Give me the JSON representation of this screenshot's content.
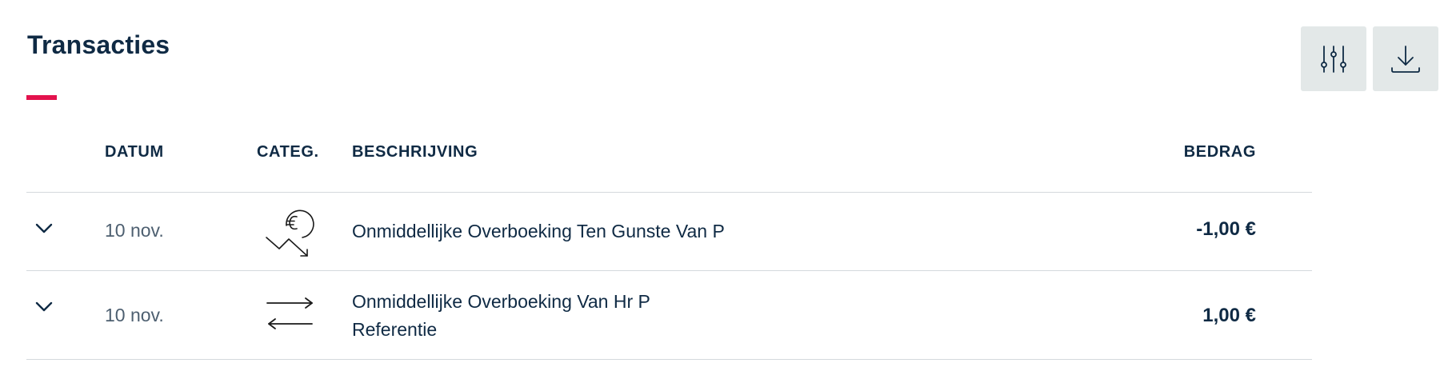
{
  "header": {
    "title": "Transacties",
    "accent_color": "#e3124d",
    "filter_button_icon": "sliders-icon",
    "download_button_icon": "download-icon"
  },
  "table": {
    "columns": {
      "datum": "DATUM",
      "categ": "CATEG.",
      "beschrijving": "BESCHRIJVING",
      "bedrag": "BEDRAG"
    },
    "rows": [
      {
        "date": "10 nov.",
        "category_icon": "euro-decrease-icon",
        "description_line1": "Onmiddellijke Overboeking Ten Gunste Van P",
        "description_line2": "",
        "amount": "-1,00 €"
      },
      {
        "date": "10 nov.",
        "category_icon": "transfer-arrows-icon",
        "description_line1": "Onmiddellijke Overboeking Van Hr P",
        "description_line2": "Referentie",
        "amount": "1,00 €"
      }
    ]
  }
}
